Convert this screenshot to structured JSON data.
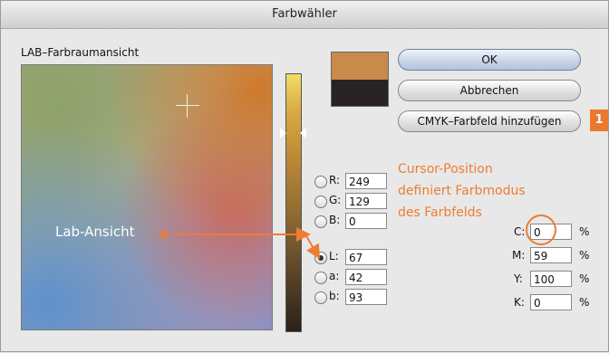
{
  "window": {
    "title": "Farbwähler"
  },
  "panel": {
    "title": "LAB–Farbraumansicht"
  },
  "buttons": {
    "ok": "OK",
    "cancel": "Abbrechen",
    "add_swatch": "CMYK–Farbfeld hinzufügen"
  },
  "badge": "1",
  "swatches": {
    "new_color": "#c98a4a",
    "old_color": "#2a2324"
  },
  "rgb": {
    "r_label": "R:",
    "r": "249",
    "g_label": "G:",
    "g": "129",
    "b_label": "B:",
    "b": "0"
  },
  "lab": {
    "l_label": "L:",
    "l": "67",
    "a_label": "a:",
    "a": "42",
    "b_label": "b:",
    "b": "93",
    "selected": "L"
  },
  "cmyk": {
    "c_label": "C:",
    "c": "0",
    "m_label": "M:",
    "m": "59",
    "y_label": "Y:",
    "y": "100",
    "k_label": "K:",
    "k": "0",
    "unit": "%"
  },
  "annotations": {
    "cursor_line1": "Cursor-Position",
    "cursor_line2": "definiert Farbmodus",
    "cursor_line3": "des Farbfelds",
    "lab_view": "Lab-Ansicht"
  },
  "colors": {
    "accent": "#ec7d32"
  }
}
